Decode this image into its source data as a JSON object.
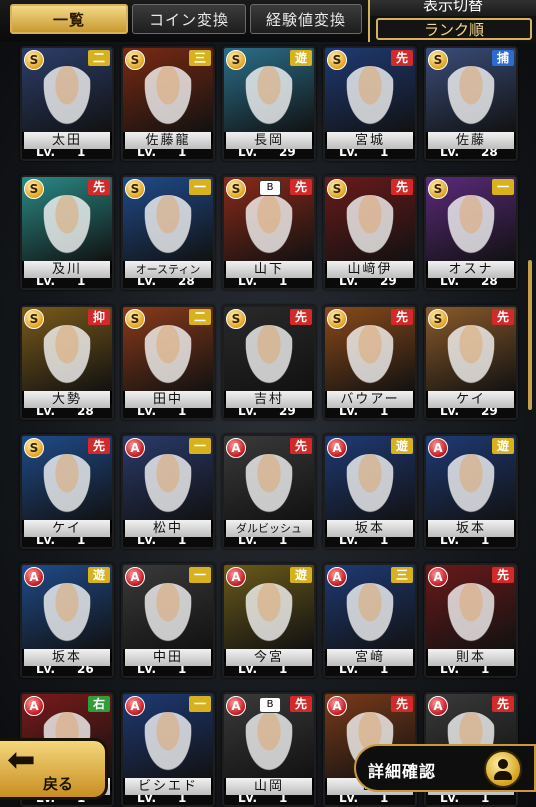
{
  "tabs": [
    {
      "label": "一覧",
      "active": true
    },
    {
      "label": "コイン変換",
      "active": false
    },
    {
      "label": "経験値変換",
      "active": false
    }
  ],
  "sort": {
    "title": "表示切替",
    "value": "ランク順"
  },
  "pos_colors": {
    "二": "#d7b21e",
    "三": "#d7b21e",
    "一": "#d7b21e",
    "遊": "#d7b21e",
    "捕": "#2a6ccf",
    "右": "#2f9e3a",
    "先": "#d22a2a",
    "抑": "#d22a2a"
  },
  "cards": [
    {
      "rank": "S",
      "pos": "二",
      "team": "",
      "name": "太田",
      "lv": "1",
      "bg": "#2c3e6a"
    },
    {
      "rank": "S",
      "pos": "三",
      "team": "",
      "name": "佐藤龍",
      "lv": "1",
      "bg": "#7a2a12"
    },
    {
      "rank": "S",
      "pos": "遊",
      "team": "",
      "name": "長岡",
      "lv": "29",
      "bg": "#2b6f8a"
    },
    {
      "rank": "S",
      "pos": "先",
      "team": "",
      "name": "宮城",
      "lv": "1",
      "bg": "#1f3a75"
    },
    {
      "rank": "S",
      "pos": "捕",
      "team": "",
      "name": "佐藤",
      "lv": "28",
      "bg": "#3a4d7a"
    },
    {
      "rank": "S",
      "pos": "先",
      "team": "",
      "name": "及川",
      "lv": "1",
      "bg": "#2a8a86"
    },
    {
      "rank": "S",
      "pos": "一",
      "team": "",
      "name": "オースティン",
      "lv": "28",
      "bg": "#1f4b8a"
    },
    {
      "rank": "S",
      "pos": "先",
      "team": "B",
      "name": "山下",
      "lv": "1",
      "bg": "#8a2a1a"
    },
    {
      "rank": "S",
      "pos": "先",
      "team": "",
      "name": "山﨑伊",
      "lv": "29",
      "bg": "#6a1a1a"
    },
    {
      "rank": "S",
      "pos": "一",
      "team": "",
      "name": "オスナ",
      "lv": "28",
      "bg": "#5a2a7a"
    },
    {
      "rank": "S",
      "pos": "抑",
      "team": "",
      "name": "大勢",
      "lv": "28",
      "bg": "#7a5a1a"
    },
    {
      "rank": "S",
      "pos": "二",
      "team": "",
      "name": "田中",
      "lv": "1",
      "bg": "#8a3a1a"
    },
    {
      "rank": "S",
      "pos": "先",
      "team": "",
      "name": "吉村",
      "lv": "29",
      "bg": "#2a2a2a"
    },
    {
      "rank": "S",
      "pos": "先",
      "team": "",
      "name": "バウアー",
      "lv": "1",
      "bg": "#8a4a1a"
    },
    {
      "rank": "S",
      "pos": "先",
      "team": "",
      "name": "ケイ",
      "lv": "29",
      "bg": "#8a5a2a"
    },
    {
      "rank": "S",
      "pos": "先",
      "team": "",
      "name": "ケイ",
      "lv": "1",
      "bg": "#1f4b8a"
    },
    {
      "rank": "A",
      "pos": "一",
      "team": "",
      "name": "松中",
      "lv": "1",
      "bg": "#2a3a6a"
    },
    {
      "rank": "A",
      "pos": "先",
      "team": "",
      "name": "ダルビッシュ",
      "lv": "1",
      "bg": "#3a3a3a"
    },
    {
      "rank": "A",
      "pos": "遊",
      "team": "",
      "name": "坂本",
      "lv": "1",
      "bg": "#1f3a75"
    },
    {
      "rank": "A",
      "pos": "遊",
      "team": "",
      "name": "坂本",
      "lv": "1",
      "bg": "#1f3a75"
    },
    {
      "rank": "A",
      "pos": "遊",
      "team": "",
      "name": "坂本",
      "lv": "26",
      "bg": "#1f4b8a"
    },
    {
      "rank": "A",
      "pos": "一",
      "team": "",
      "name": "中田",
      "lv": "1",
      "bg": "#3a3a3a"
    },
    {
      "rank": "A",
      "pos": "遊",
      "team": "",
      "name": "今宮",
      "lv": "1",
      "bg": "#6a5a1a"
    },
    {
      "rank": "A",
      "pos": "三",
      "team": "",
      "name": "宮﨑",
      "lv": "1",
      "bg": "#1f3a75"
    },
    {
      "rank": "A",
      "pos": "先",
      "team": "",
      "name": "則本",
      "lv": "1",
      "bg": "#6a1a1a"
    },
    {
      "rank": "A",
      "pos": "右",
      "team": "",
      "name": "",
      "lv": "1",
      "bg": "#7a1a1a"
    },
    {
      "rank": "A",
      "pos": "一",
      "team": "",
      "name": "ビシエド",
      "lv": "1",
      "bg": "#1f3a75"
    },
    {
      "rank": "A",
      "pos": "先",
      "team": "B",
      "name": "山岡",
      "lv": "1",
      "bg": "#3a3a3a"
    },
    {
      "rank": "A",
      "pos": "先",
      "team": "",
      "name": "山",
      "lv": "1",
      "bg": "#7a3a1a"
    },
    {
      "rank": "A",
      "pos": "先",
      "team": "",
      "name": "",
      "lv": "1",
      "bg": "#3a3a3a"
    }
  ],
  "lv_prefix": "Lv.",
  "back": {
    "label": "戻る"
  },
  "detail": {
    "label": "詳細確認"
  }
}
